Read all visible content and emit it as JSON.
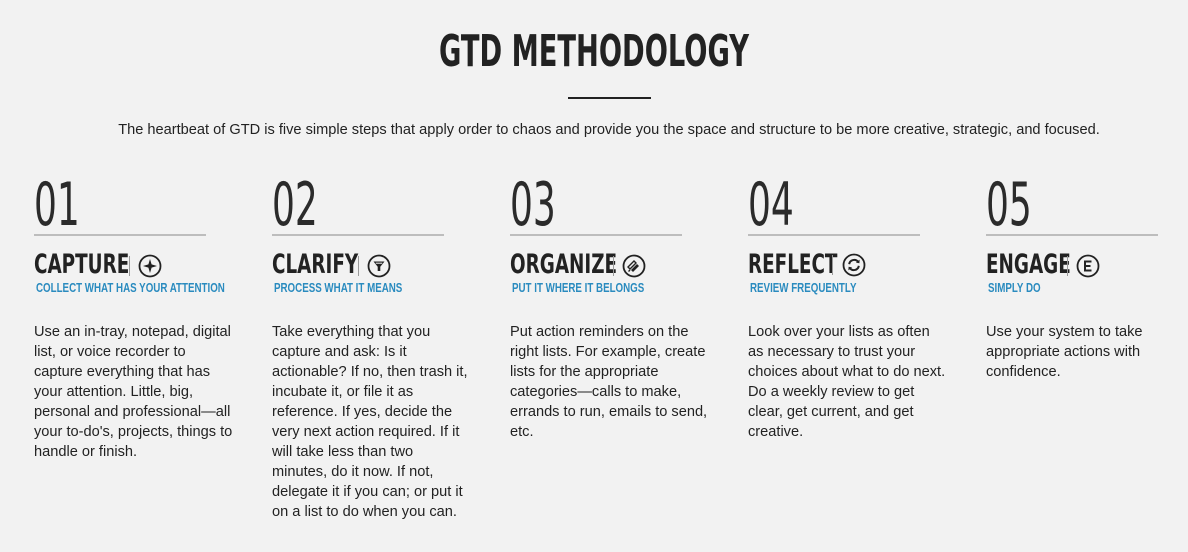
{
  "header": {
    "title": "GTD METHODOLOGY",
    "intro": "The heartbeat of GTD is five simple steps that apply order to chaos and provide you the space and structure to be more creative, strategic, and focused."
  },
  "colors": {
    "background": "#f2f2f2",
    "text": "#222222",
    "accent_blue": "#2a8bbf",
    "rule_gray": "#bdbdbd"
  },
  "steps": [
    {
      "number": "01",
      "name": "CAPTURE",
      "icon": "capture-compass-icon",
      "subtitle": "COLLECT WHAT HAS YOUR ATTENTION",
      "body": "Use an in-tray, notepad, digital list, or voice recorder to capture everything that has your attention. Little, big, personal and professional—all your to-do's, projects, things to handle or finish."
    },
    {
      "number": "02",
      "name": "CLARIFY",
      "icon": "clarify-funnel-icon",
      "subtitle": "PROCESS WHAT IT MEANS",
      "body": "Take everything that you capture and ask: Is it actionable? If no, then trash it, incubate it, or file it as reference. If yes, decide the very next action required. If it will take less than two minutes, do it now. If not, delegate it if you can; or put it on a list to do when you can."
    },
    {
      "number": "03",
      "name": "ORGANIZE",
      "icon": "organize-stack-icon",
      "subtitle": "PUT IT WHERE IT BELONGS",
      "body": "Put action reminders on the right lists. For example, create lists for the appropriate categories—calls to make, errands to run, emails to send, etc."
    },
    {
      "number": "04",
      "name": "REFLECT",
      "icon": "reflect-refresh-icon",
      "subtitle": "REVIEW FREQUENTLY",
      "body": "Look over your lists as often as necessary to trust your choices about what to do next. Do a weekly review to get clear, get current, and get creative."
    },
    {
      "number": "05",
      "name": "ENGAGE",
      "icon": "engage-e-icon",
      "subtitle": "SIMPLY DO",
      "body": "Use your system to take appropriate actions with confidence."
    }
  ]
}
